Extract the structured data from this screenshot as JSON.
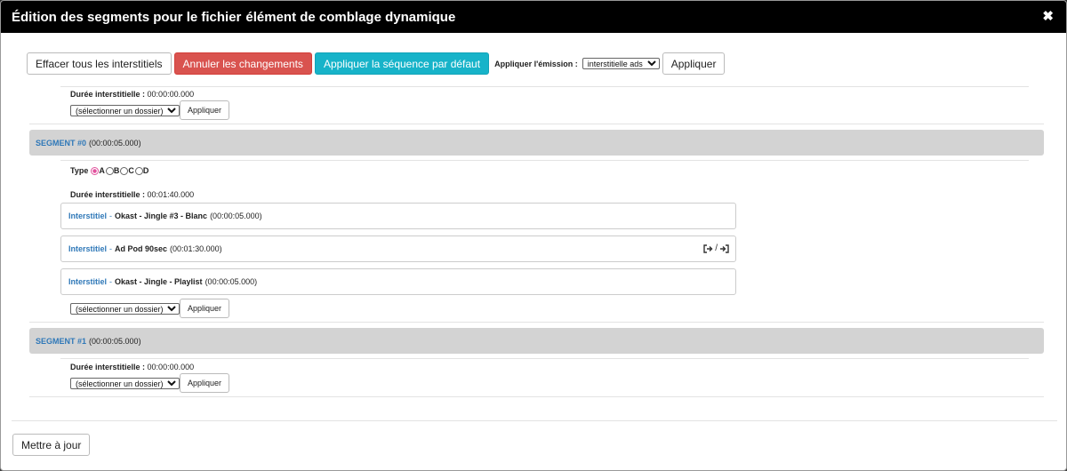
{
  "modal": {
    "title_prefix": "Édition des segments pour le fichier",
    "title_file": "élément de comblage dynamique",
    "close_symbol": "✖"
  },
  "toolbar": {
    "clear_label": "Effacer tous les interstitiels",
    "cancel_label": "Annuler les changements",
    "apply_default_label": "Appliquer la séquence par défaut",
    "apply_emission_label": "Appliquer l'émission :",
    "emission_selected": "interstitielle ads",
    "apply_label": "Appliquer"
  },
  "top_block": {
    "duration_label": "Durée interstitielle :",
    "duration_value": "00:00:00.000",
    "folder_selected": "(sélectionner un dossier)",
    "apply_label": "Appliquer"
  },
  "segments": [
    {
      "name": "SEGMENT #0",
      "duration": "(00:00:05.000)",
      "type_label": "Type",
      "type_options": [
        "A",
        "B",
        "C",
        "D"
      ],
      "type_selected": "A",
      "duration_label": "Durée interstitielle :",
      "duration_value": "00:01:40.000",
      "items": [
        {
          "kind": "Interstitiel",
          "sep": "-",
          "name": "Okast - Jingle #3 - Blanc",
          "duration": "(00:00:05.000)"
        },
        {
          "kind": "Interstitiel",
          "sep": "-",
          "name": "Ad Pod 90sec",
          "duration": "(00:01:30.000)",
          "actions_sep": "/"
        },
        {
          "kind": "Interstitiel",
          "sep": "-",
          "name": "Okast - Jingle - Playlist",
          "duration": "(00:00:05.000)"
        }
      ],
      "folder_selected": "(sélectionner un dossier)",
      "apply_label": "Appliquer"
    },
    {
      "name": "SEGMENT #1",
      "duration": "(00:00:05.000)",
      "duration_label": "Durée interstitielle :",
      "duration_value": "00:00:00.000",
      "folder_selected": "(sélectionner un dossier)",
      "apply_label": "Appliquer"
    }
  ],
  "footer": {
    "update_label": "Mettre à jour"
  },
  "colors": {
    "header_bg": "#000000",
    "danger": "#d9534f",
    "info": "#17b3c9",
    "link": "#2f78b8",
    "segment_bar": "#d3d3d3",
    "radio_checked": "#e2529e"
  },
  "icons": [
    "close-icon",
    "sign-out-icon",
    "sign-in-icon",
    "chevron-down-icon"
  ]
}
